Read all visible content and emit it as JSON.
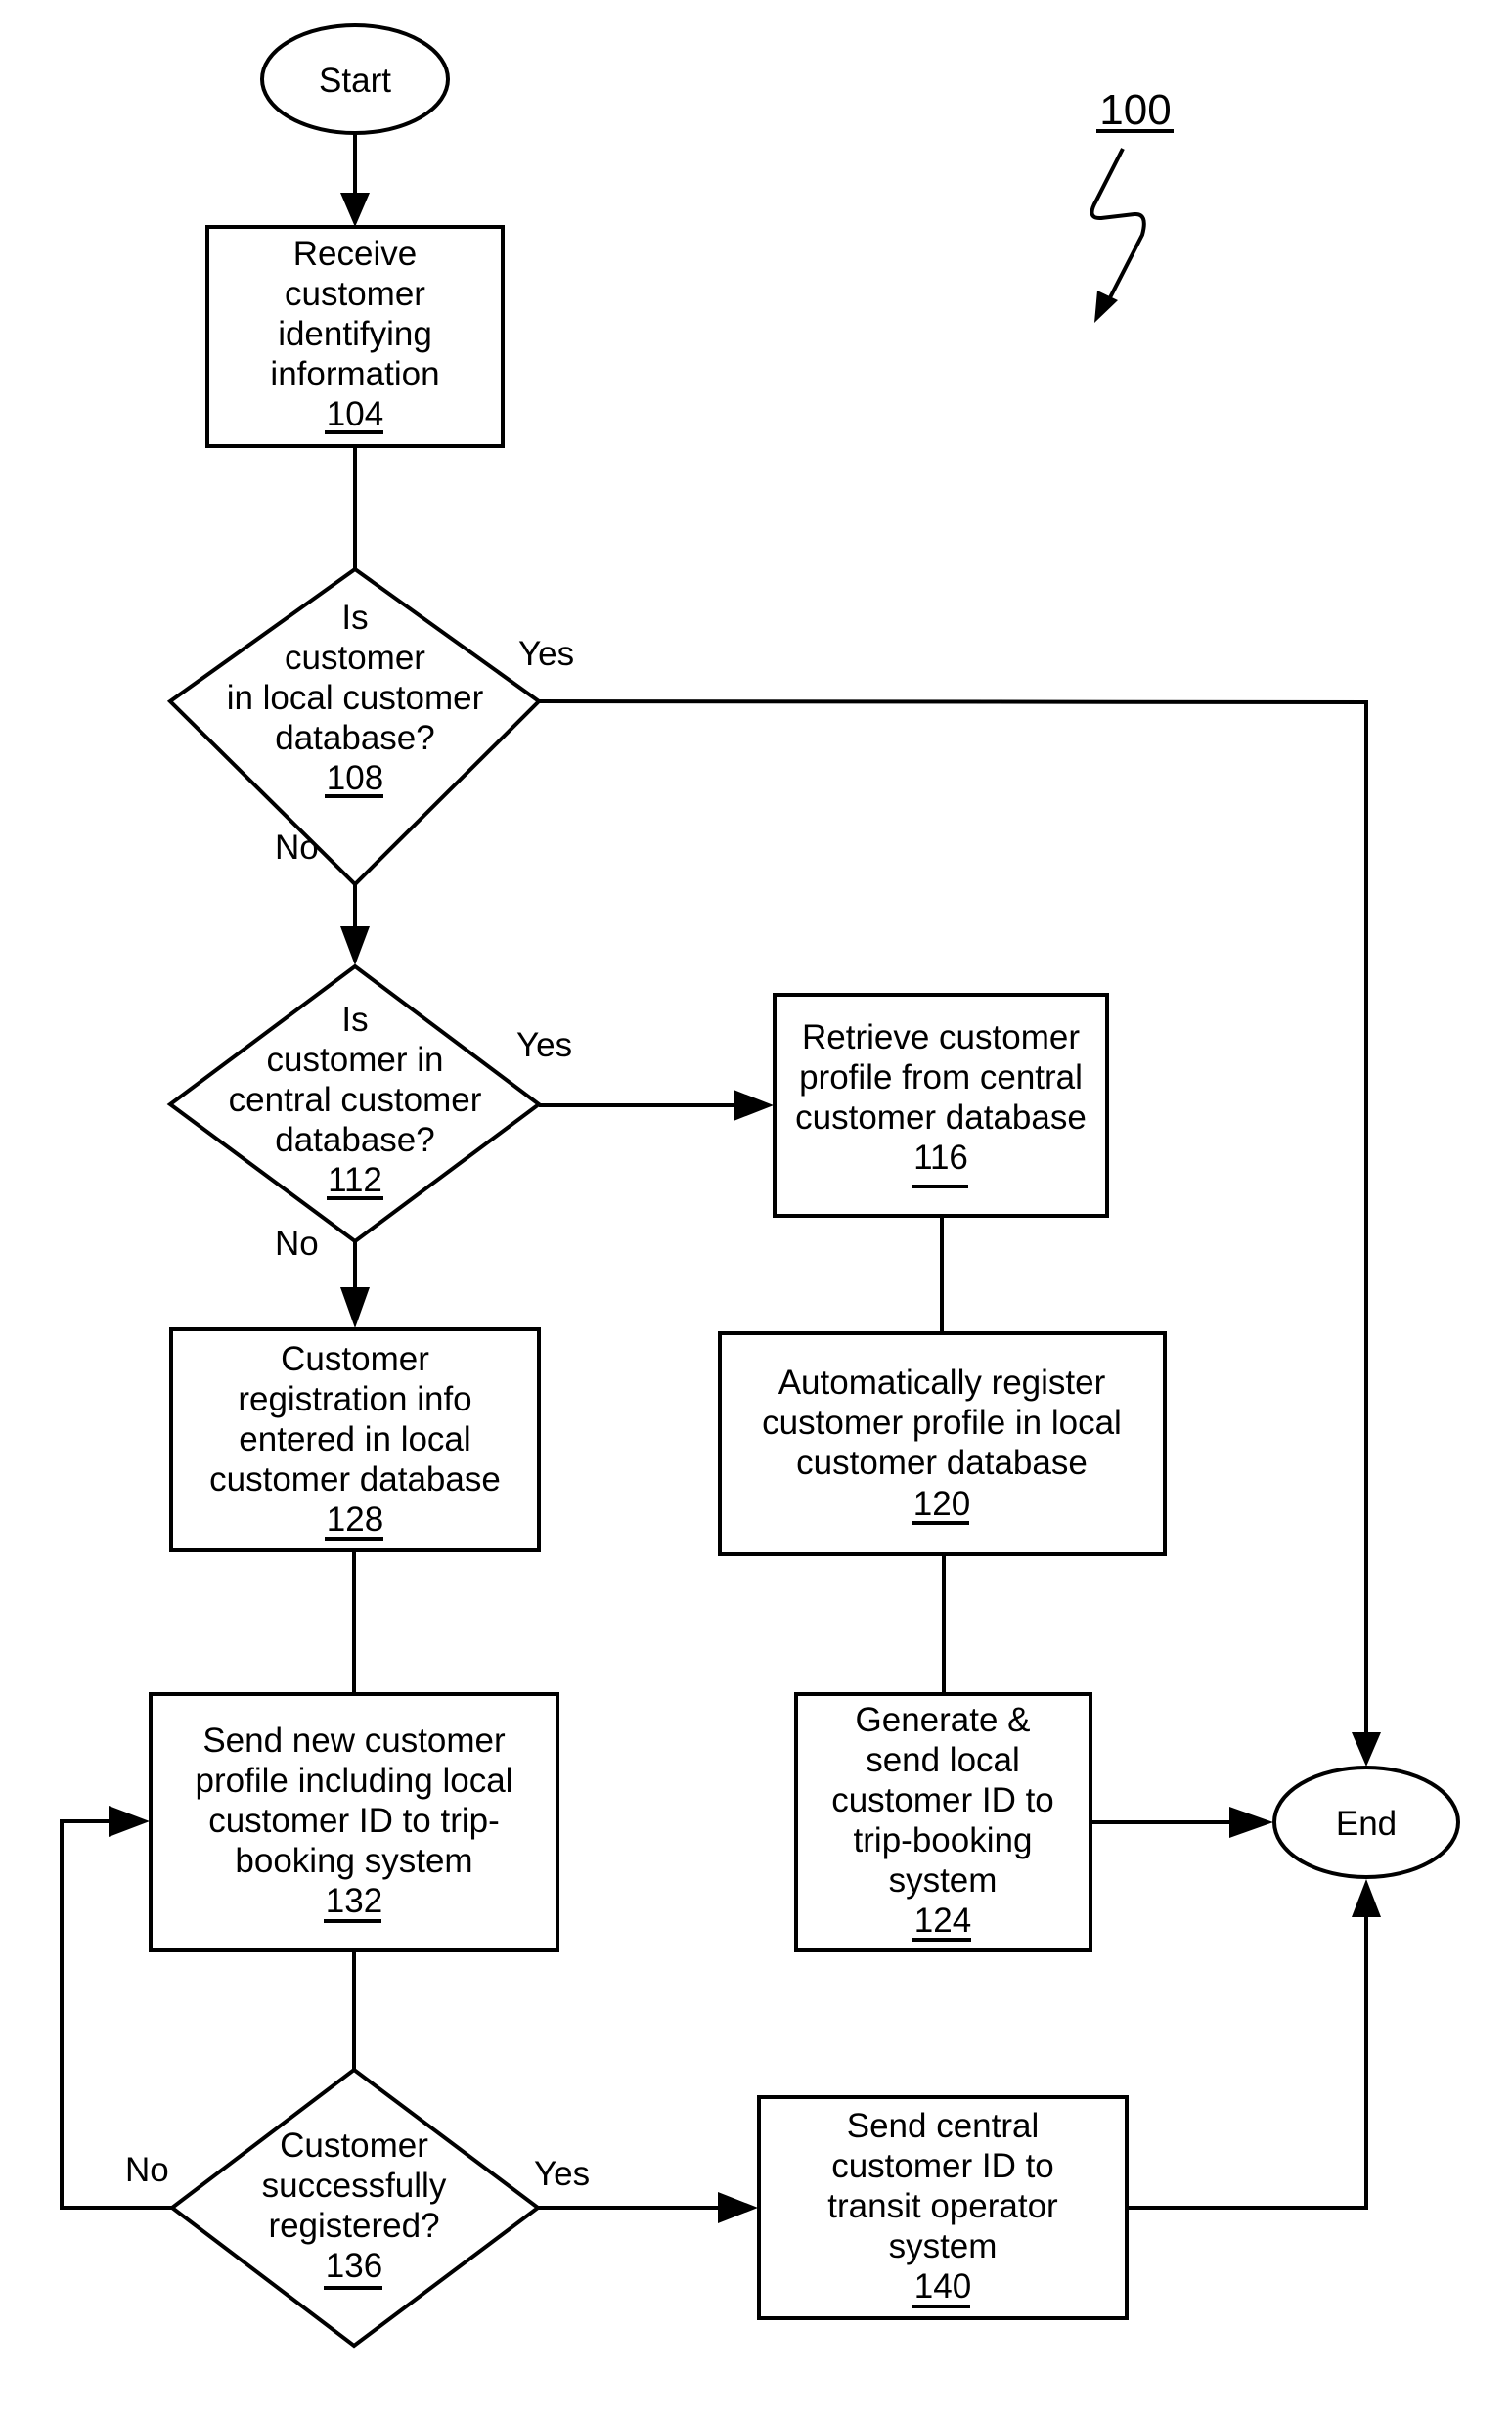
{
  "figure": {
    "reference": "100"
  },
  "nodes": {
    "start": {
      "type": "terminal",
      "label": "Start"
    },
    "n104": {
      "type": "process",
      "lines": [
        "Receive",
        "customer",
        "identifying",
        "information"
      ],
      "ref": "104"
    },
    "n108": {
      "type": "decision",
      "lines": [
        "Is",
        "customer",
        "in local customer",
        "database?"
      ],
      "ref": "108"
    },
    "n112": {
      "type": "decision",
      "lines": [
        "Is",
        "customer in",
        "central customer",
        "database?"
      ],
      "ref": "112"
    },
    "n116": {
      "type": "process",
      "lines": [
        "Retrieve customer",
        "profile from central",
        "customer database"
      ],
      "ref": "116"
    },
    "n120": {
      "type": "process",
      "lines": [
        "Automatically register",
        "customer profile in local",
        "customer database"
      ],
      "ref": "120"
    },
    "n124": {
      "type": "process",
      "lines": [
        "Generate &",
        "send local",
        "customer ID to",
        "trip-booking",
        "system"
      ],
      "ref": "124"
    },
    "n128": {
      "type": "process",
      "lines": [
        "Customer",
        "registration info",
        "entered in local",
        "customer database"
      ],
      "ref": "128"
    },
    "n132": {
      "type": "process",
      "lines": [
        "Send new customer",
        "profile including local",
        "customer ID to trip-",
        "booking system"
      ],
      "ref": "132"
    },
    "n136": {
      "type": "decision",
      "lines": [
        "Customer",
        "successfully",
        "registered?"
      ],
      "ref": "136"
    },
    "n140": {
      "type": "process",
      "lines": [
        "Send central",
        "customer ID to",
        "transit operator",
        "system"
      ],
      "ref": "140"
    },
    "end": {
      "type": "terminal",
      "label": "End"
    }
  },
  "edges": [
    {
      "from": "start",
      "to": "n104",
      "label": ""
    },
    {
      "from": "n104",
      "to": "n108",
      "label": ""
    },
    {
      "from": "n108",
      "to": "end",
      "label": "Yes"
    },
    {
      "from": "n108",
      "to": "n112",
      "label": "No"
    },
    {
      "from": "n112",
      "to": "n116",
      "label": "Yes"
    },
    {
      "from": "n112",
      "to": "n128",
      "label": "No"
    },
    {
      "from": "n116",
      "to": "n120",
      "label": ""
    },
    {
      "from": "n120",
      "to": "n124",
      "label": ""
    },
    {
      "from": "n124",
      "to": "end",
      "label": ""
    },
    {
      "from": "n128",
      "to": "n132",
      "label": ""
    },
    {
      "from": "n132",
      "to": "n136",
      "label": ""
    },
    {
      "from": "n136",
      "to": "n140",
      "label": "Yes"
    },
    {
      "from": "n136",
      "to": "n132",
      "label": "No"
    },
    {
      "from": "n140",
      "to": "end",
      "label": ""
    }
  ],
  "edge_labels": {
    "yes": "Yes",
    "no": "No"
  }
}
